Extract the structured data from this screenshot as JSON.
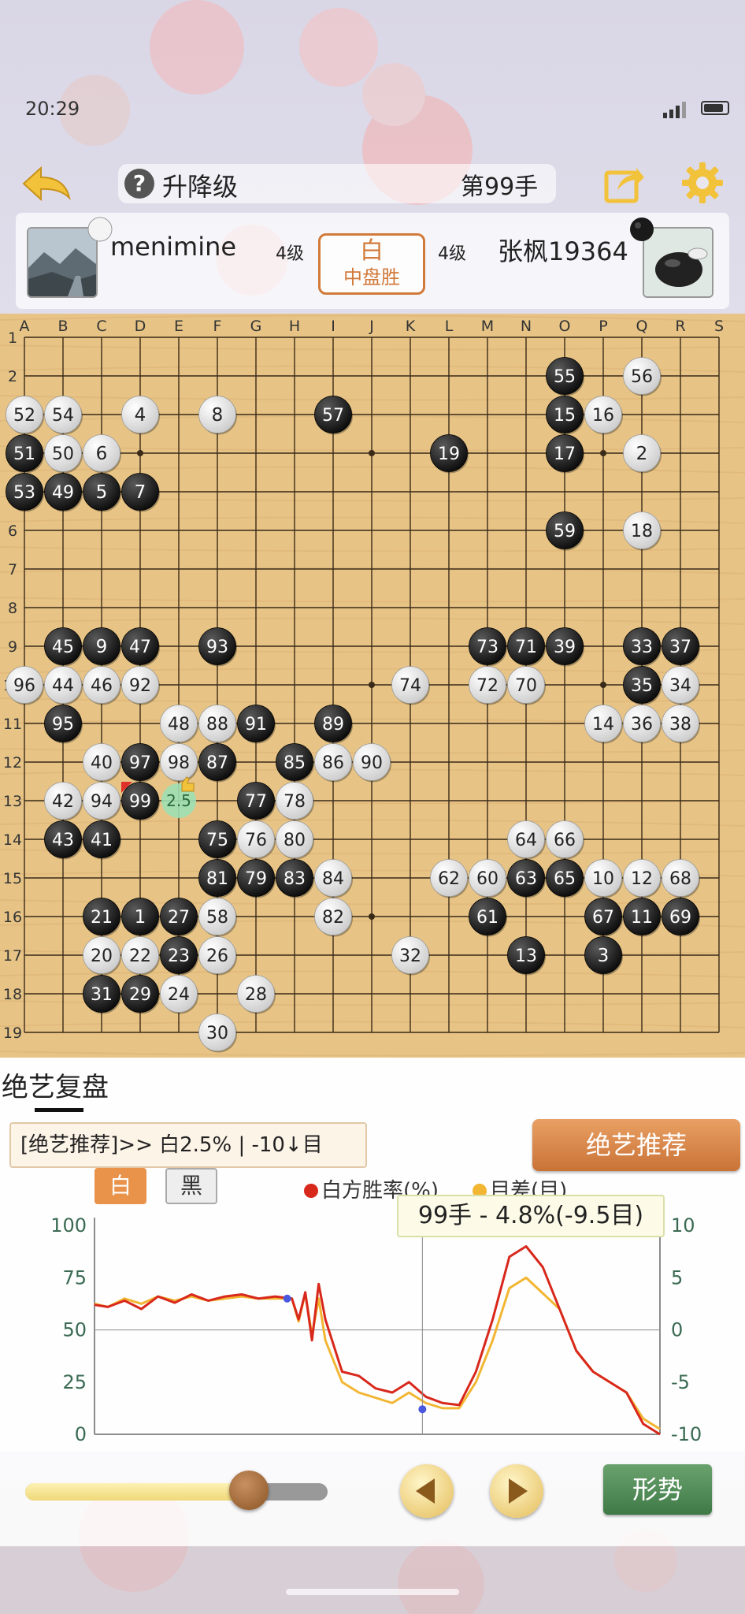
{
  "status": {
    "time": "20:29"
  },
  "header": {
    "title": "升降级",
    "move": "第99手"
  },
  "players": {
    "left": {
      "name": "meniminе",
      "rank": "4级",
      "color": "white"
    },
    "right": {
      "name": "张枫19364",
      "rank": "4级",
      "color": "black"
    },
    "result_color": "白",
    "result_text": "中盘胜"
  },
  "board": {
    "columns": [
      "A",
      "B",
      "C",
      "D",
      "E",
      "F",
      "G",
      "H",
      "I",
      "J",
      "K",
      "L",
      "M",
      "N",
      "O",
      "P",
      "Q",
      "R",
      "S"
    ],
    "rows": [
      "1",
      "2",
      "3",
      "4",
      "5",
      "6",
      "7",
      "8",
      "9",
      "10",
      "11",
      "12",
      "13",
      "14",
      "15",
      "16",
      "17",
      "18",
      "19"
    ],
    "hint_label": "2.5",
    "stones": [
      {
        "n": "1",
        "c": "b",
        "pos": "D16"
      },
      {
        "n": "2",
        "c": "w",
        "pos": "Q4"
      },
      {
        "n": "3",
        "c": "b",
        "pos": "P17"
      },
      {
        "n": "4",
        "c": "w",
        "pos": "D3"
      },
      {
        "n": "5",
        "c": "b",
        "pos": "C5"
      },
      {
        "n": "6",
        "c": "w",
        "pos": "C4"
      },
      {
        "n": "7",
        "c": "b",
        "pos": "D5"
      },
      {
        "n": "8",
        "c": "w",
        "pos": "F3"
      },
      {
        "n": "9",
        "c": "b",
        "pos": "C9"
      },
      {
        "n": "10",
        "c": "w",
        "pos": "P15"
      },
      {
        "n": "11",
        "c": "b",
        "pos": "Q16"
      },
      {
        "n": "12",
        "c": "w",
        "pos": "Q15"
      },
      {
        "n": "13",
        "c": "b",
        "pos": "N17"
      },
      {
        "n": "14",
        "c": "w",
        "pos": "P11"
      },
      {
        "n": "15",
        "c": "b",
        "pos": "O3"
      },
      {
        "n": "16",
        "c": "w",
        "pos": "P3"
      },
      {
        "n": "17",
        "c": "b",
        "pos": "O4"
      },
      {
        "n": "18",
        "c": "w",
        "pos": "Q6"
      },
      {
        "n": "19",
        "c": "b",
        "pos": "L4"
      },
      {
        "n": "20",
        "c": "w",
        "pos": "C17"
      },
      {
        "n": "21",
        "c": "b",
        "pos": "C16"
      },
      {
        "n": "22",
        "c": "w",
        "pos": "D17"
      },
      {
        "n": "23",
        "c": "b",
        "pos": "E17"
      },
      {
        "n": "24",
        "c": "w",
        "pos": "E18"
      },
      {
        "n": "26",
        "c": "w",
        "pos": "F17"
      },
      {
        "n": "27",
        "c": "b",
        "pos": "E16"
      },
      {
        "n": "28",
        "c": "w",
        "pos": "G18"
      },
      {
        "n": "29",
        "c": "b",
        "pos": "D18"
      },
      {
        "n": "30",
        "c": "w",
        "pos": "F19"
      },
      {
        "n": "31",
        "c": "b",
        "pos": "C18"
      },
      {
        "n": "32",
        "c": "w",
        "pos": "K17"
      },
      {
        "n": "33",
        "c": "b",
        "pos": "Q9"
      },
      {
        "n": "34",
        "c": "w",
        "pos": "R10"
      },
      {
        "n": "35",
        "c": "b",
        "pos": "Q10"
      },
      {
        "n": "36",
        "c": "w",
        "pos": "Q11"
      },
      {
        "n": "37",
        "c": "b",
        "pos": "R9"
      },
      {
        "n": "38",
        "c": "w",
        "pos": "R11"
      },
      {
        "n": "39",
        "c": "b",
        "pos": "O9"
      },
      {
        "n": "40",
        "c": "w",
        "pos": "C12"
      },
      {
        "n": "41",
        "c": "b",
        "pos": "C14"
      },
      {
        "n": "42",
        "c": "w",
        "pos": "B13"
      },
      {
        "n": "43",
        "c": "b",
        "pos": "B14"
      },
      {
        "n": "44",
        "c": "w",
        "pos": "B10"
      },
      {
        "n": "45",
        "c": "b",
        "pos": "B9"
      },
      {
        "n": "46",
        "c": "w",
        "pos": "C10"
      },
      {
        "n": "47",
        "c": "b",
        "pos": "D9"
      },
      {
        "n": "48",
        "c": "w",
        "pos": "E11"
      },
      {
        "n": "49",
        "c": "b",
        "pos": "B5"
      },
      {
        "n": "50",
        "c": "w",
        "pos": "B4"
      },
      {
        "n": "51",
        "c": "b",
        "pos": "A4"
      },
      {
        "n": "52",
        "c": "w",
        "pos": "A3"
      },
      {
        "n": "53",
        "c": "b",
        "pos": "A5"
      },
      {
        "n": "54",
        "c": "w",
        "pos": "B3"
      },
      {
        "n": "55",
        "c": "b",
        "pos": "O2"
      },
      {
        "n": "56",
        "c": "w",
        "pos": "Q2"
      },
      {
        "n": "57",
        "c": "b",
        "pos": "I3"
      },
      {
        "n": "58",
        "c": "w",
        "pos": "F16"
      },
      {
        "n": "59",
        "c": "b",
        "pos": "O6"
      },
      {
        "n": "60",
        "c": "w",
        "pos": "M15"
      },
      {
        "n": "61",
        "c": "b",
        "pos": "M16"
      },
      {
        "n": "62",
        "c": "w",
        "pos": "L15"
      },
      {
        "n": "63",
        "c": "b",
        "pos": "N15"
      },
      {
        "n": "64",
        "c": "w",
        "pos": "N14"
      },
      {
        "n": "65",
        "c": "b",
        "pos": "O15"
      },
      {
        "n": "66",
        "c": "w",
        "pos": "O14"
      },
      {
        "n": "67",
        "c": "b",
        "pos": "P16"
      },
      {
        "n": "68",
        "c": "w",
        "pos": "R15"
      },
      {
        "n": "69",
        "c": "b",
        "pos": "R16"
      },
      {
        "n": "70",
        "c": "w",
        "pos": "N10"
      },
      {
        "n": "71",
        "c": "b",
        "pos": "N9"
      },
      {
        "n": "72",
        "c": "w",
        "pos": "M10"
      },
      {
        "n": "73",
        "c": "b",
        "pos": "M9"
      },
      {
        "n": "74",
        "c": "w",
        "pos": "K10"
      },
      {
        "n": "75",
        "c": "b",
        "pos": "F14"
      },
      {
        "n": "76",
        "c": "w",
        "pos": "G14"
      },
      {
        "n": "77",
        "c": "b",
        "pos": "G13"
      },
      {
        "n": "78",
        "c": "w",
        "pos": "H13"
      },
      {
        "n": "79",
        "c": "b",
        "pos": "G15"
      },
      {
        "n": "80",
        "c": "w",
        "pos": "H14"
      },
      {
        "n": "81",
        "c": "b",
        "pos": "F15"
      },
      {
        "n": "82",
        "c": "w",
        "pos": "I16"
      },
      {
        "n": "83",
        "c": "b",
        "pos": "H15"
      },
      {
        "n": "84",
        "c": "w",
        "pos": "I15"
      },
      {
        "n": "85",
        "c": "b",
        "pos": "H12"
      },
      {
        "n": "86",
        "c": "w",
        "pos": "I12"
      },
      {
        "n": "87",
        "c": "b",
        "pos": "F12"
      },
      {
        "n": "88",
        "c": "w",
        "pos": "F11"
      },
      {
        "n": "89",
        "c": "b",
        "pos": "I11"
      },
      {
        "n": "90",
        "c": "w",
        "pos": "J12"
      },
      {
        "n": "91",
        "c": "b",
        "pos": "G11"
      },
      {
        "n": "92",
        "c": "w",
        "pos": "D10"
      },
      {
        "n": "93",
        "c": "b",
        "pos": "F9"
      },
      {
        "n": "94",
        "c": "w",
        "pos": "C13"
      },
      {
        "n": "95",
        "c": "b",
        "pos": "B11"
      },
      {
        "n": "96",
        "c": "w",
        "pos": "A10"
      },
      {
        "n": "97",
        "c": "b",
        "pos": "D12"
      },
      {
        "n": "98",
        "c": "w",
        "pos": "E12"
      },
      {
        "n": "99",
        "c": "b",
        "pos": "D13"
      }
    ]
  },
  "review": {
    "title": "绝艺复盘",
    "recommend_text": "[绝艺推荐]>> 白2.5% | -10↓目",
    "recommend_button": "绝艺推荐",
    "tab_white": "白",
    "tab_black": "黑",
    "legend_win": "白方胜率(%)",
    "legend_diff": "目差(目)",
    "tooltip": "99手 - 4.8%(-9.5目)"
  },
  "chart_data": {
    "type": "line",
    "x": [
      1,
      5,
      10,
      15,
      20,
      25,
      30,
      35,
      40,
      45,
      50,
      55,
      60,
      62,
      64,
      66,
      68,
      70,
      75,
      80,
      85,
      90,
      95,
      100,
      105,
      110,
      115,
      120,
      125,
      130,
      135,
      140,
      145,
      150,
      155,
      160,
      165,
      170
    ],
    "series": [
      {
        "name": "白方胜率(%)",
        "color": "#d8281c",
        "axis": "left",
        "values": [
          62,
          61,
          64,
          60,
          66,
          63,
          67,
          64,
          66,
          67,
          65,
          66,
          65,
          55,
          68,
          45,
          72,
          55,
          30,
          28,
          22,
          20,
          25,
          18,
          15,
          14,
          30,
          55,
          85,
          90,
          80,
          60,
          40,
          30,
          25,
          20,
          5,
          0
        ]
      },
      {
        "name": "目差(目)",
        "color": "#f2b632",
        "axis": "right",
        "values": [
          2.5,
          2.2,
          3.0,
          2.5,
          3.2,
          2.8,
          3.2,
          2.8,
          3.0,
          3.2,
          3.0,
          3.0,
          3.0,
          0.8,
          3.5,
          -0.5,
          3.0,
          -1.0,
          -5.0,
          -6.0,
          -6.5,
          -7.0,
          -6.0,
          -7.0,
          -7.5,
          -7.5,
          -5.0,
          -1.0,
          4.0,
          5.0,
          3.5,
          2.0,
          -2.0,
          -4.0,
          -5.0,
          -6.0,
          -8.5,
          -9.5
        ]
      }
    ],
    "left_axis": {
      "ticks": [
        "100",
        "75",
        "50",
        "25",
        "0"
      ],
      "ylim": [
        0,
        100
      ]
    },
    "right_axis": {
      "ticks": [
        "10",
        "5",
        "0",
        "-5",
        "-10"
      ],
      "ylim": [
        -10,
        10
      ]
    },
    "current_move": 99
  },
  "controls": {
    "situation_button": "形势",
    "slider_progress": 0.74
  },
  "colors": {
    "accent": "#d27a3a",
    "board": "#e7c486",
    "green": "#4d8a54"
  }
}
